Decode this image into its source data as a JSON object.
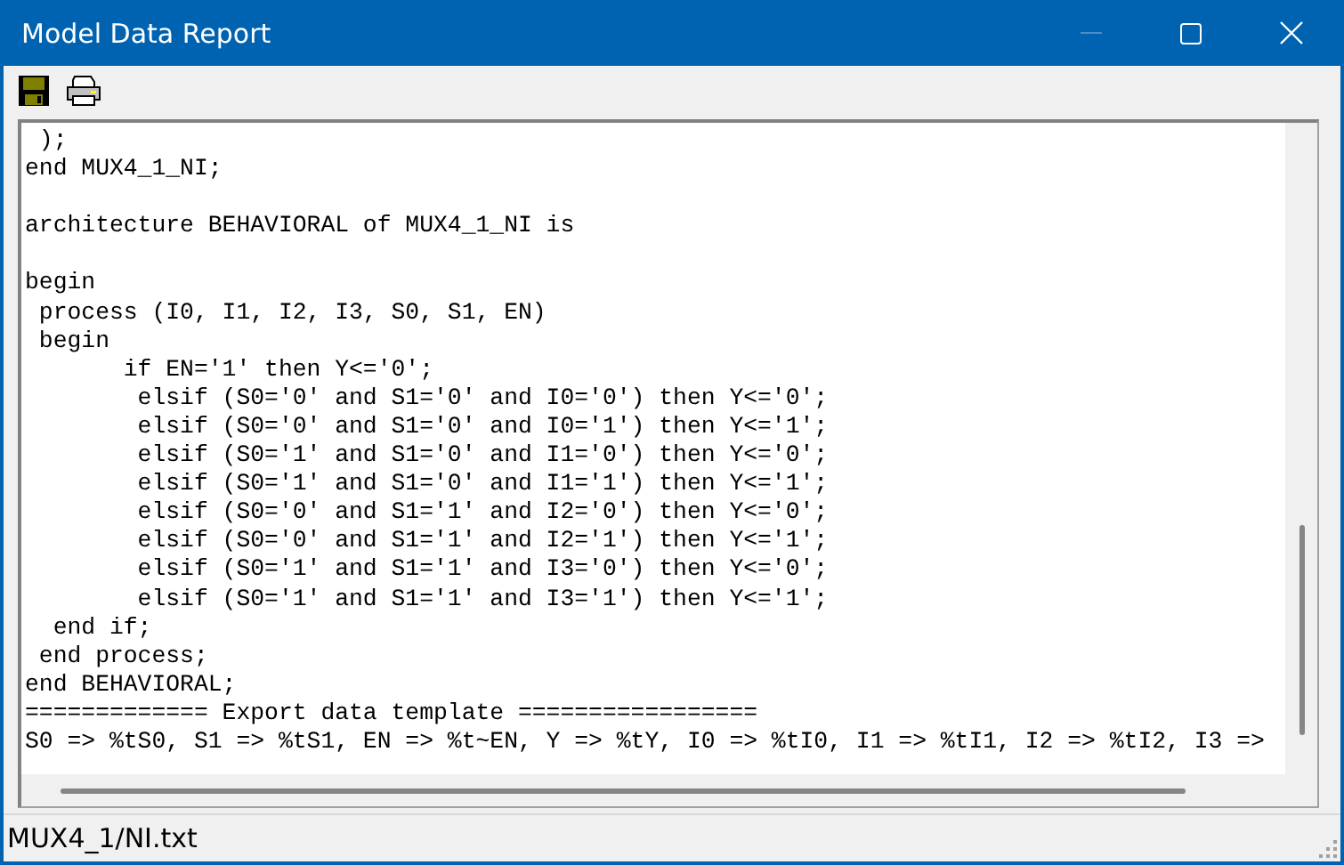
{
  "window": {
    "title": "Model Data Report"
  },
  "toolbar": {
    "buttons": [
      {
        "kind": "save"
      },
      {
        "kind": "print"
      }
    ]
  },
  "report": {
    "blocks": [
      [
        " );",
        "end MUX4_1_NI;"
      ],
      [
        "architecture BEHAVIORAL of MUX4_1_NI is"
      ],
      [
        "begin",
        " process (I0, I1, I2, I3, S0, S1, EN)",
        " begin",
        "       if EN='1' then Y<='0';",
        "        elsif (S0='0' and S1='0' and I0='0') then Y<='0';",
        "        elsif (S0='0' and S1='0' and I0='1') then Y<='1';",
        "        elsif (S0='1' and S1='0' and I1='0') then Y<='0';",
        "        elsif (S0='1' and S1='0' and I1='1') then Y<='1';",
        "        elsif (S0='0' and S1='1' and I2='0') then Y<='0';",
        "        elsif (S0='0' and S1='1' and I2='1') then Y<='1';",
        "        elsif (S0='1' and S1='1' and I3='0') then Y<='0';",
        "        elsif (S0='1' and S1='1' and I3='1') then Y<='1';",
        "  end if;",
        " end process;",
        "end BEHAVIORAL;",
        "============= Export data template =================",
        "S0 => %tS0, S1 => %tS1, EN => %t~EN, Y => %tY, I0 => %tI0, I1 => %tI1, I2 => %tI2, I3 =>"
      ]
    ]
  },
  "status_bar": {
    "text": "MUX4_1/NI.txt"
  }
}
